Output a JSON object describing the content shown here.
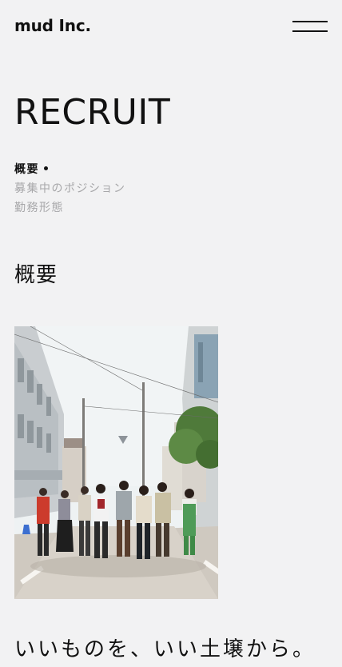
{
  "header": {
    "logo_text": "mud Inc.",
    "menu_icon": "hamburger-menu-icon"
  },
  "page": {
    "title": "RECRUIT"
  },
  "subnav": {
    "items": [
      {
        "label": "概要",
        "active": true
      },
      {
        "label": "募集中のポジション",
        "active": false
      },
      {
        "label": "勤務形態",
        "active": false
      }
    ]
  },
  "section": {
    "heading": "概要"
  },
  "hero_image": {
    "subject": "group of people walking down a residential street"
  },
  "tagline": "いいものを、いい土壌から。",
  "colors": {
    "background": "#f2f2f3",
    "text": "#111111",
    "muted": "#a7a7a9"
  }
}
